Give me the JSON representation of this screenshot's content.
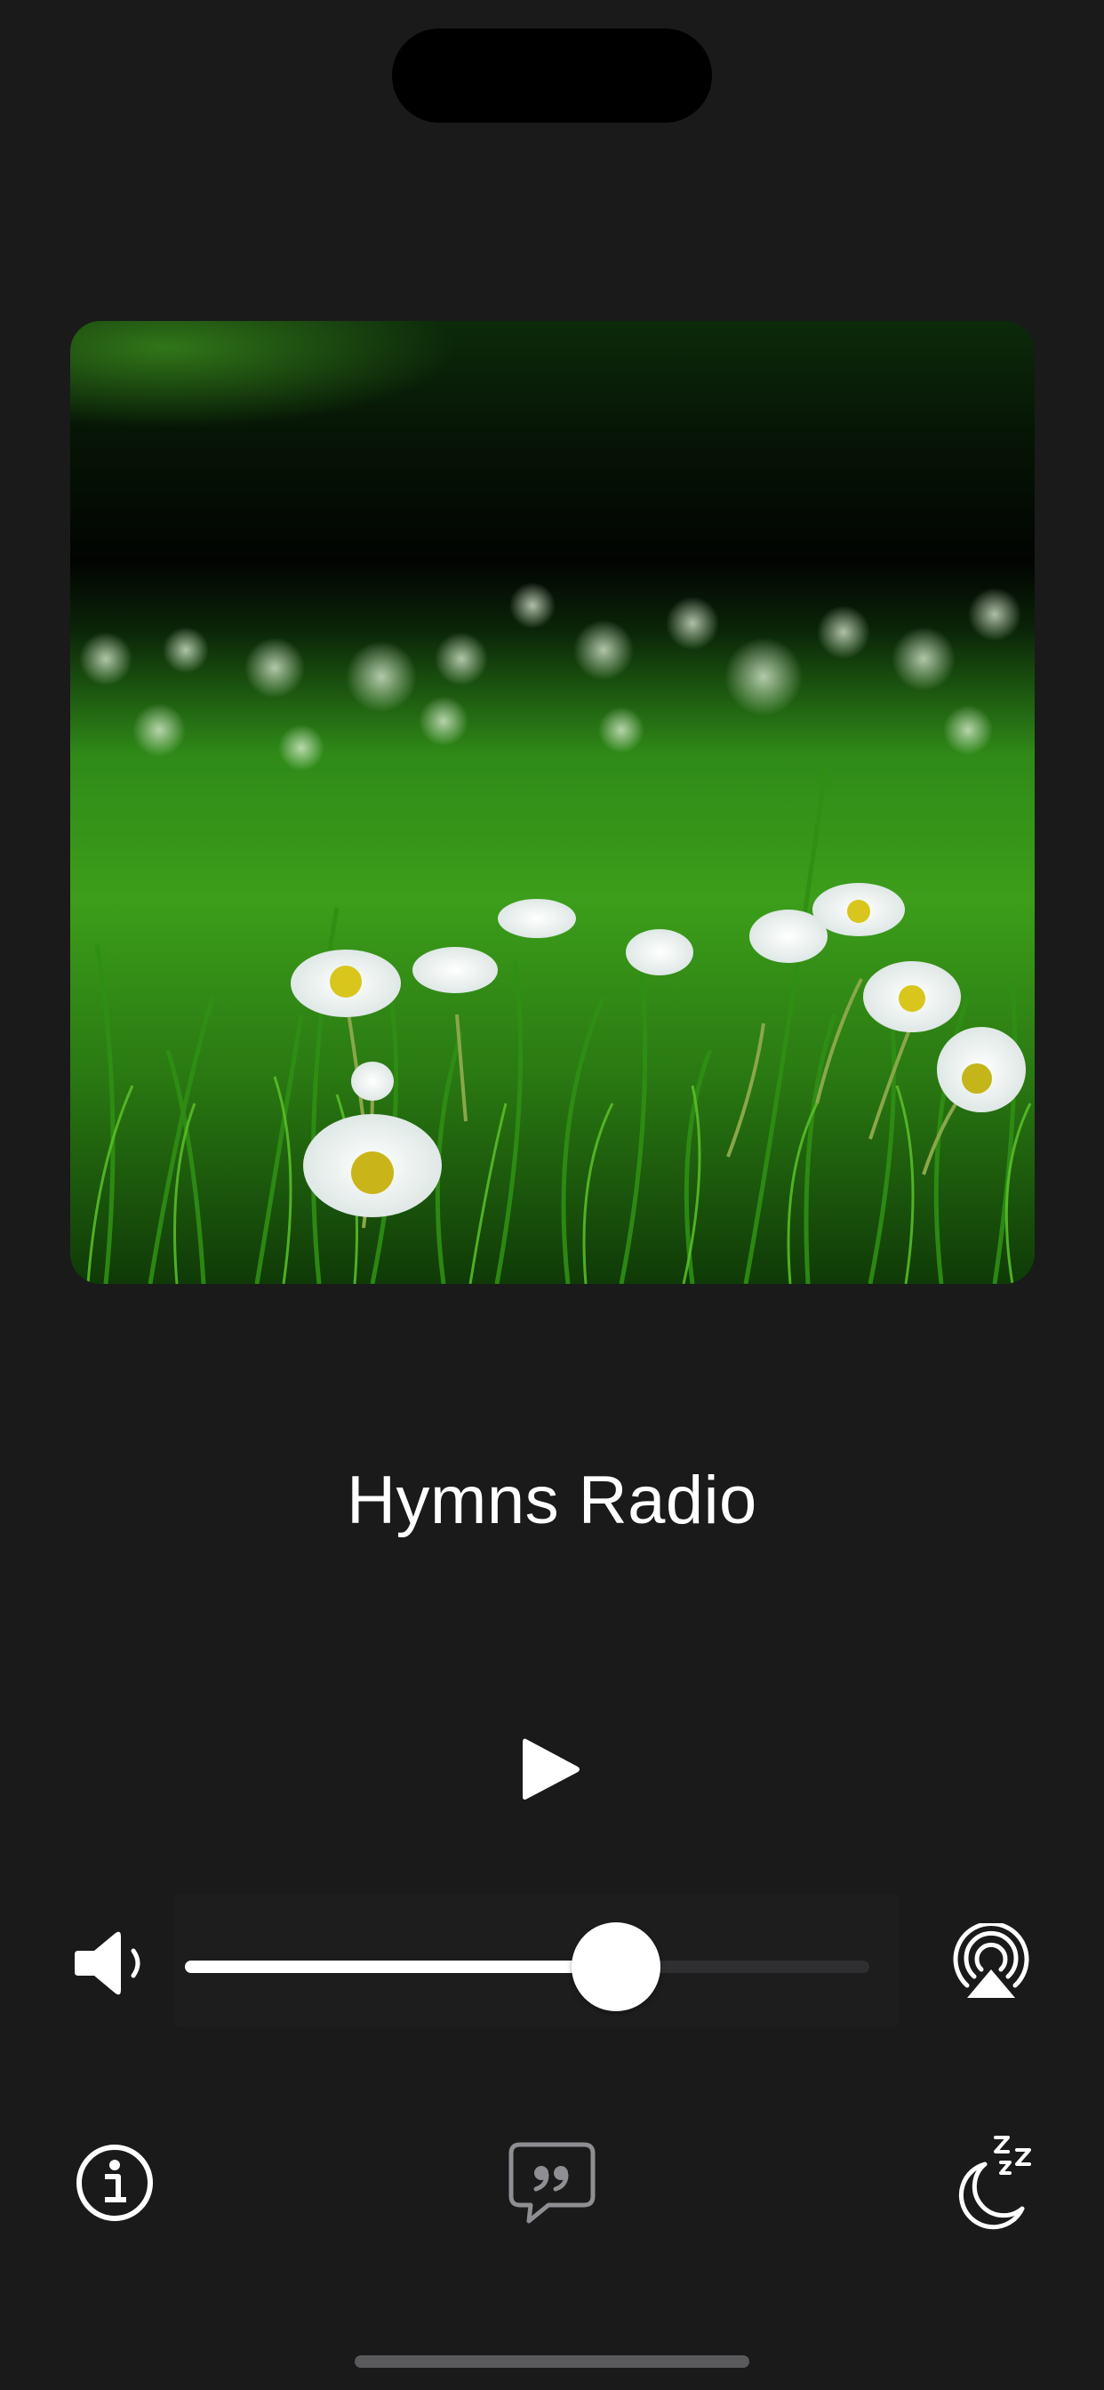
{
  "player": {
    "station_title": "Hymns Radio",
    "artwork_description": "daisy-field-artwork",
    "is_playing": false,
    "play_icon": "play-icon"
  },
  "volume": {
    "level": 0.63,
    "min_icon": "speaker-icon",
    "route_icon": "airplay-icon"
  },
  "toolbar": {
    "info_icon": "info-icon",
    "lyrics_icon": "quote-bubble-icon",
    "sleep_icon": "sleep-timer-icon"
  },
  "colors": {
    "background": "#1a1a1a",
    "foreground": "#ffffff",
    "track": "#2f2f31",
    "muted_icon": "#8e8e93"
  }
}
